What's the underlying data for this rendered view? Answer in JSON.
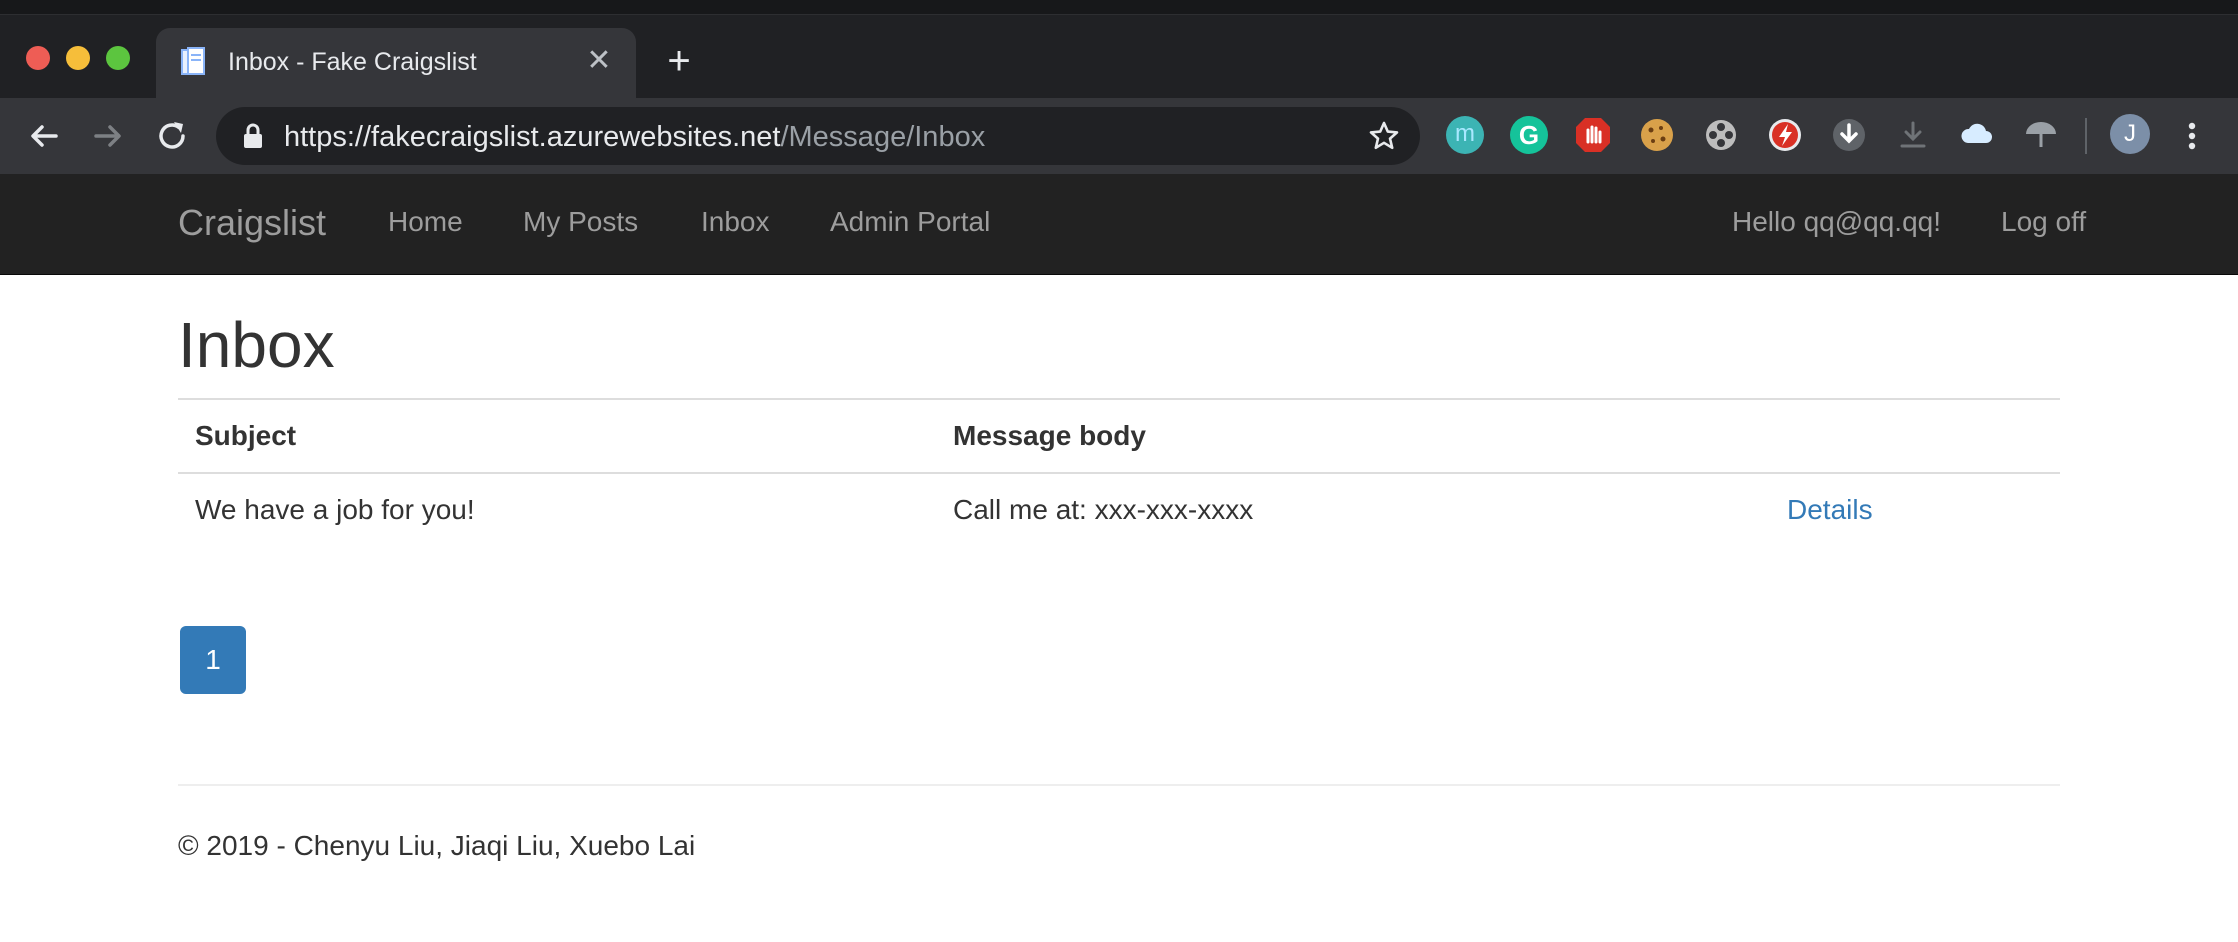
{
  "browser": {
    "tab_title": "Inbox - Fake Craigslist",
    "url_host": "https://fakecraigslist.azurewebsites.net",
    "url_path": "/Message/Inbox",
    "profile_initial": "J"
  },
  "site": {
    "brand": "Craigslist",
    "nav": {
      "home": "Home",
      "my_posts": "My Posts",
      "inbox": "Inbox",
      "admin_portal": "Admin Portal",
      "greeting": "Hello qq@qq.qq!",
      "log_off": "Log off"
    }
  },
  "page": {
    "title": "Inbox",
    "table": {
      "headers": {
        "subject": "Subject",
        "body": "Message body"
      },
      "rows": [
        {
          "subject": "We have a job for you!",
          "body": "Call me at: xxx-xxx-xxxx",
          "action": "Details"
        }
      ]
    },
    "pagination": {
      "current_page": "1"
    },
    "footer": "© 2019 - Chenyu Liu, Jiaqi Liu, Xuebo Lai"
  },
  "colors": {
    "navbar_bg": "#222222",
    "link": "#337ab7",
    "pager_active": "#337ab7"
  },
  "icons": [
    "back-arrow-icon",
    "forward-arrow-icon",
    "reload-icon",
    "lock-icon",
    "star-icon",
    "extension-m-icon",
    "grammarly-icon",
    "stop-hand-icon",
    "cookie-icon",
    "film-reel-icon",
    "flash-icon",
    "download-circle-icon",
    "download-tray-icon",
    "cloud-icon",
    "umbrella-icon",
    "kebab-menu-icon"
  ]
}
